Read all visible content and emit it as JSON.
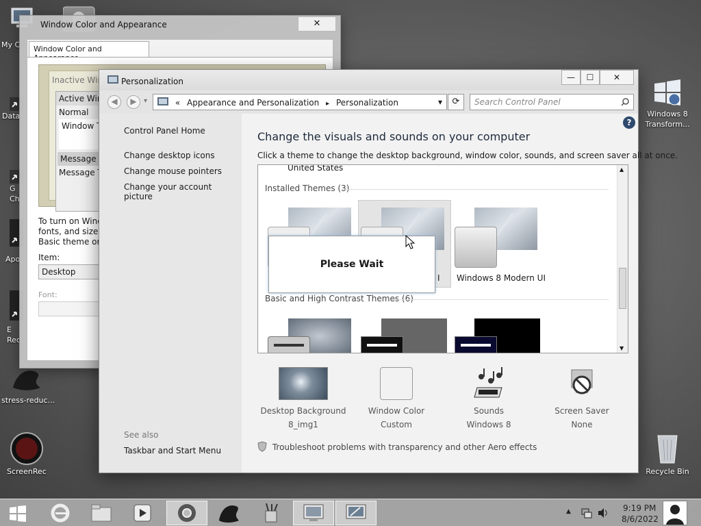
{
  "desktop": {
    "icons_left": [
      {
        "label": "My C",
        "icon": "computer-icon"
      },
      {
        "label": "Data",
        "icon": "shortcut-icon"
      },
      {
        "label": "G Ch",
        "icon": "shortcut-icon"
      },
      {
        "label": "Apo",
        "icon": "shortcut-icon"
      },
      {
        "label": "E Rec",
        "icon": "shortcut-icon"
      },
      {
        "label": "stress-reduc...",
        "icon": "splash-icon"
      },
      {
        "label": "ScreenRec",
        "icon": "record-icon"
      }
    ],
    "icons_right": [
      {
        "label": "Windows 8 Transform...",
        "icon": "windows-logo-icon"
      },
      {
        "label": "Recycle Bin",
        "icon": "recycle-bin-icon"
      }
    ]
  },
  "back_window": {
    "title": "Window Color and Appearance",
    "close": "✕",
    "tab": "Window Color and Appearance",
    "preview": {
      "inactive": "Inactive Wind",
      "active": "Active Wind",
      "normal": "Normal",
      "window_text": "Window Tex",
      "message_box": "Message B",
      "message_text": "Message T"
    },
    "description_lines": [
      "To turn on Windo",
      "fonts, and sizes se",
      "Basic theme or a h"
    ],
    "item_label": "Item:",
    "item_value": "Desktop",
    "font_label": "Font:"
  },
  "personalization": {
    "title": "Personalization",
    "buttons": {
      "minimize": "—",
      "maximize": "☐",
      "close": "✕"
    },
    "nav": {
      "back": "◀",
      "forward": "▶",
      "recent": "▾",
      "address_prefix": "«",
      "breadcrumb_1": "Appearance and Personalization",
      "sep": "▸",
      "breadcrumb_2": "Personalization",
      "dropdown": "▾",
      "refresh": "⟳",
      "search_placeholder": "Search Control Panel"
    },
    "left": {
      "home": "Control Panel Home",
      "links": [
        "Change desktop icons",
        "Change mouse pointers",
        "Change your account picture"
      ],
      "see_also": "See also",
      "see_also_link": "Taskbar and Start Menu"
    },
    "heading": "Change the visuals and sounds on your computer",
    "subheading": "Click a theme to change the desktop background, window color, sounds, and screen saver all at once.",
    "help": "?",
    "list": {
      "top_item": "United States",
      "installed_header": "Installed Themes (3)",
      "installed_theme_label": "I",
      "modern_theme_label": "Windows 8 Modern UI",
      "basic_header": "Basic and High Contrast Themes (6)",
      "please_wait": "Please Wait"
    },
    "bottom": [
      {
        "title": "Desktop Background",
        "value": "8_img1"
      },
      {
        "title": "Window Color",
        "value": "Custom"
      },
      {
        "title": "Sounds",
        "value": "Windows 8"
      },
      {
        "title": "Screen Saver",
        "value": "None"
      }
    ],
    "troubleshoot": "Troubleshoot problems with transparency and other Aero effects"
  },
  "taskbar": {
    "time": "9:19 PM",
    "date": "8/6/2022",
    "tray_arrow": "▲"
  }
}
